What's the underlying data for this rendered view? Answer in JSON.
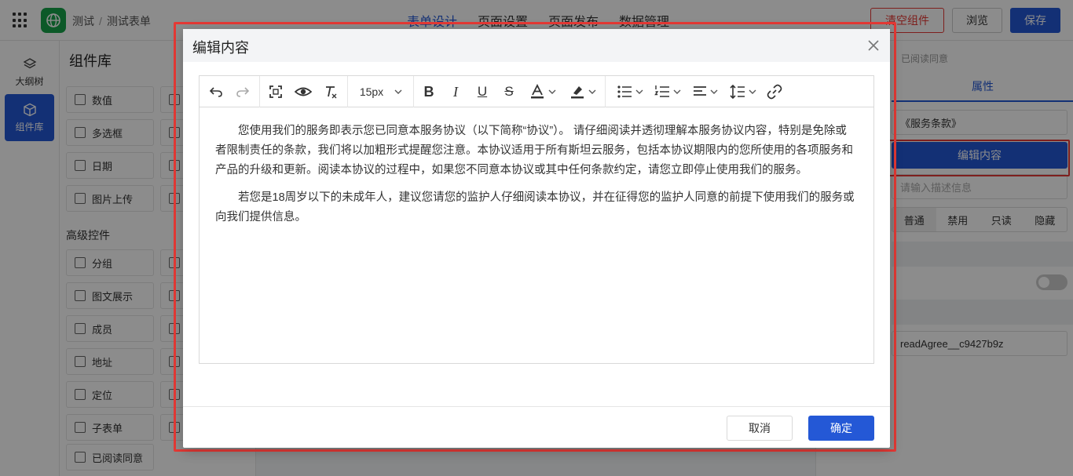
{
  "header": {
    "breadcrumb": [
      "测试",
      "测试表单"
    ],
    "nav_tabs": [
      "表单设计",
      "页面设置",
      "页面发布",
      "数据管理"
    ],
    "active_tab": "表单设计",
    "clear_label": "清空组件",
    "preview_label": "浏览",
    "save_label": "保存"
  },
  "rail": {
    "outline_label": "大纲树",
    "library_label": "组件库"
  },
  "panel": {
    "title": "组件库",
    "basic_items": [
      "数值",
      "多选框",
      "日期",
      "图片上传"
    ],
    "advanced_title": "高级控件",
    "advanced_items": [
      "分组",
      "图文展示",
      "成员",
      "地址",
      "定位",
      "子表单",
      "已阅读同意"
    ]
  },
  "props": {
    "subtitle": "已阅读同意",
    "tab_label": "属性",
    "title_value": "《服务条款》",
    "edit_button": "编辑内容",
    "desc_placeholder": "请输入描述信息",
    "status_options": [
      "普通",
      "禁用",
      "只读",
      "隐藏"
    ],
    "status_selected": "普通",
    "field_id": "readAgree__c9427b9z"
  },
  "modal": {
    "title": "编辑内容",
    "font_size": "15px",
    "paragraphs": [
      "您使用我们的服务即表示您已同意本服务协议（以下简称“协议”）。 请仔细阅读并透彻理解本服务协议内容，特别是免除或者限制责任的条款，我们将以加粗形式提醒您注意。本协议适用于所有斯坦云服务，包括本协议期限内的您所使用的各项服务和产品的升级和更新。阅读本协议的过程中，如果您不同意本协议或其中任何条款约定，请您立即停止使用我们的服务。",
      "若您是18周岁以下的未成年人，建议您请您的监护人仔细阅读本协议，并在征得您的监护人同意的前提下使用我们的服务或向我们提供信息。"
    ],
    "cancel_label": "取消",
    "confirm_label": "确定"
  },
  "colors": {
    "primary": "#2458d6",
    "danger": "#e53935",
    "logo": "#16a34a"
  }
}
